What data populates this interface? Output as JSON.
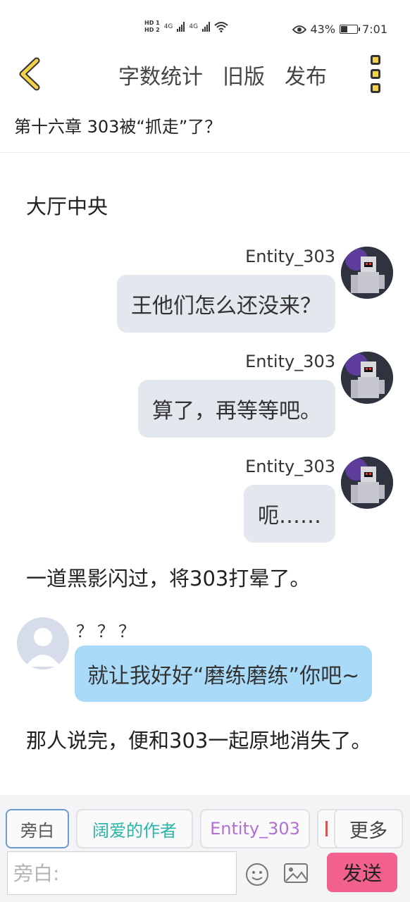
{
  "status_bar": {
    "hd_top": "HD 1",
    "hd_bottom": "HD 2",
    "net1": "4G",
    "net2": "4G",
    "battery_percent": "43%",
    "battery_level": 0.43,
    "time": "7:01"
  },
  "toolbar": {
    "word_count": "字数统计",
    "old_version": "旧版",
    "publish": "发布"
  },
  "chapter_title": "第十六章 303被“抓走”了？",
  "content": {
    "narration_1": "大厅中央",
    "messages_right": [
      {
        "name": "Entity_303",
        "text": "王他们怎么还没来？"
      },
      {
        "name": "Entity_303",
        "text": "算了，再等等吧。"
      },
      {
        "name": "Entity_303",
        "text": "呃……"
      }
    ],
    "narration_2": "一道黑影闪过，将303打晕了。",
    "message_left": {
      "name": "？？？",
      "text": "就让我好好“磨练磨练”你吧~"
    },
    "narration_3": "那人说完，便和303一起原地消失了。"
  },
  "bottom": {
    "roles": [
      "旁白",
      "阔爱的作者",
      "Entity_303"
    ],
    "more": "更多",
    "input_placeholder": "旁白:",
    "send": "发送"
  },
  "colors": {
    "send_button": "#f2608d",
    "bubble_right": "#e3e7ee",
    "bubble_left": "#a9dbf8",
    "back_arrow": "#f3d24a"
  }
}
